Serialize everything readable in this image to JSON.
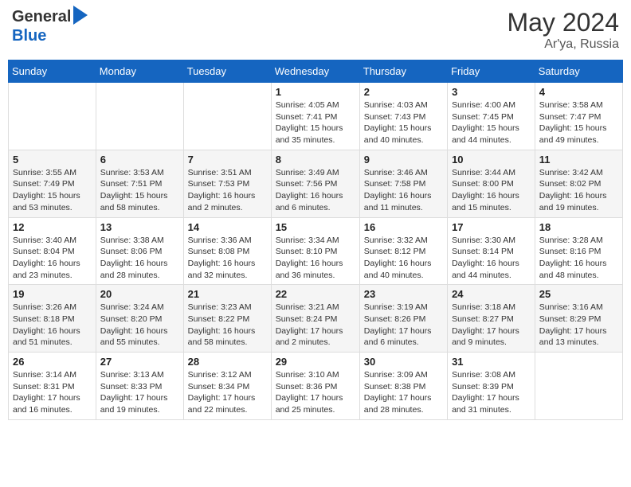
{
  "header": {
    "logo_general": "General",
    "logo_blue": "Blue",
    "month_year": "May 2024",
    "location": "Ar'ya, Russia"
  },
  "weekdays": [
    "Sunday",
    "Monday",
    "Tuesday",
    "Wednesday",
    "Thursday",
    "Friday",
    "Saturday"
  ],
  "weeks": [
    [
      {
        "day": "",
        "info": ""
      },
      {
        "day": "",
        "info": ""
      },
      {
        "day": "",
        "info": ""
      },
      {
        "day": "1",
        "info": "Sunrise: 4:05 AM\nSunset: 7:41 PM\nDaylight: 15 hours\nand 35 minutes."
      },
      {
        "day": "2",
        "info": "Sunrise: 4:03 AM\nSunset: 7:43 PM\nDaylight: 15 hours\nand 40 minutes."
      },
      {
        "day": "3",
        "info": "Sunrise: 4:00 AM\nSunset: 7:45 PM\nDaylight: 15 hours\nand 44 minutes."
      },
      {
        "day": "4",
        "info": "Sunrise: 3:58 AM\nSunset: 7:47 PM\nDaylight: 15 hours\nand 49 minutes."
      }
    ],
    [
      {
        "day": "5",
        "info": "Sunrise: 3:55 AM\nSunset: 7:49 PM\nDaylight: 15 hours\nand 53 minutes."
      },
      {
        "day": "6",
        "info": "Sunrise: 3:53 AM\nSunset: 7:51 PM\nDaylight: 15 hours\nand 58 minutes."
      },
      {
        "day": "7",
        "info": "Sunrise: 3:51 AM\nSunset: 7:53 PM\nDaylight: 16 hours\nand 2 minutes."
      },
      {
        "day": "8",
        "info": "Sunrise: 3:49 AM\nSunset: 7:56 PM\nDaylight: 16 hours\nand 6 minutes."
      },
      {
        "day": "9",
        "info": "Sunrise: 3:46 AM\nSunset: 7:58 PM\nDaylight: 16 hours\nand 11 minutes."
      },
      {
        "day": "10",
        "info": "Sunrise: 3:44 AM\nSunset: 8:00 PM\nDaylight: 16 hours\nand 15 minutes."
      },
      {
        "day": "11",
        "info": "Sunrise: 3:42 AM\nSunset: 8:02 PM\nDaylight: 16 hours\nand 19 minutes."
      }
    ],
    [
      {
        "day": "12",
        "info": "Sunrise: 3:40 AM\nSunset: 8:04 PM\nDaylight: 16 hours\nand 23 minutes."
      },
      {
        "day": "13",
        "info": "Sunrise: 3:38 AM\nSunset: 8:06 PM\nDaylight: 16 hours\nand 28 minutes."
      },
      {
        "day": "14",
        "info": "Sunrise: 3:36 AM\nSunset: 8:08 PM\nDaylight: 16 hours\nand 32 minutes."
      },
      {
        "day": "15",
        "info": "Sunrise: 3:34 AM\nSunset: 8:10 PM\nDaylight: 16 hours\nand 36 minutes."
      },
      {
        "day": "16",
        "info": "Sunrise: 3:32 AM\nSunset: 8:12 PM\nDaylight: 16 hours\nand 40 minutes."
      },
      {
        "day": "17",
        "info": "Sunrise: 3:30 AM\nSunset: 8:14 PM\nDaylight: 16 hours\nand 44 minutes."
      },
      {
        "day": "18",
        "info": "Sunrise: 3:28 AM\nSunset: 8:16 PM\nDaylight: 16 hours\nand 48 minutes."
      }
    ],
    [
      {
        "day": "19",
        "info": "Sunrise: 3:26 AM\nSunset: 8:18 PM\nDaylight: 16 hours\nand 51 minutes."
      },
      {
        "day": "20",
        "info": "Sunrise: 3:24 AM\nSunset: 8:20 PM\nDaylight: 16 hours\nand 55 minutes."
      },
      {
        "day": "21",
        "info": "Sunrise: 3:23 AM\nSunset: 8:22 PM\nDaylight: 16 hours\nand 58 minutes."
      },
      {
        "day": "22",
        "info": "Sunrise: 3:21 AM\nSunset: 8:24 PM\nDaylight: 17 hours\nand 2 minutes."
      },
      {
        "day": "23",
        "info": "Sunrise: 3:19 AM\nSunset: 8:26 PM\nDaylight: 17 hours\nand 6 minutes."
      },
      {
        "day": "24",
        "info": "Sunrise: 3:18 AM\nSunset: 8:27 PM\nDaylight: 17 hours\nand 9 minutes."
      },
      {
        "day": "25",
        "info": "Sunrise: 3:16 AM\nSunset: 8:29 PM\nDaylight: 17 hours\nand 13 minutes."
      }
    ],
    [
      {
        "day": "26",
        "info": "Sunrise: 3:14 AM\nSunset: 8:31 PM\nDaylight: 17 hours\nand 16 minutes."
      },
      {
        "day": "27",
        "info": "Sunrise: 3:13 AM\nSunset: 8:33 PM\nDaylight: 17 hours\nand 19 minutes."
      },
      {
        "day": "28",
        "info": "Sunrise: 3:12 AM\nSunset: 8:34 PM\nDaylight: 17 hours\nand 22 minutes."
      },
      {
        "day": "29",
        "info": "Sunrise: 3:10 AM\nSunset: 8:36 PM\nDaylight: 17 hours\nand 25 minutes."
      },
      {
        "day": "30",
        "info": "Sunrise: 3:09 AM\nSunset: 8:38 PM\nDaylight: 17 hours\nand 28 minutes."
      },
      {
        "day": "31",
        "info": "Sunrise: 3:08 AM\nSunset: 8:39 PM\nDaylight: 17 hours\nand 31 minutes."
      },
      {
        "day": "",
        "info": ""
      }
    ]
  ]
}
